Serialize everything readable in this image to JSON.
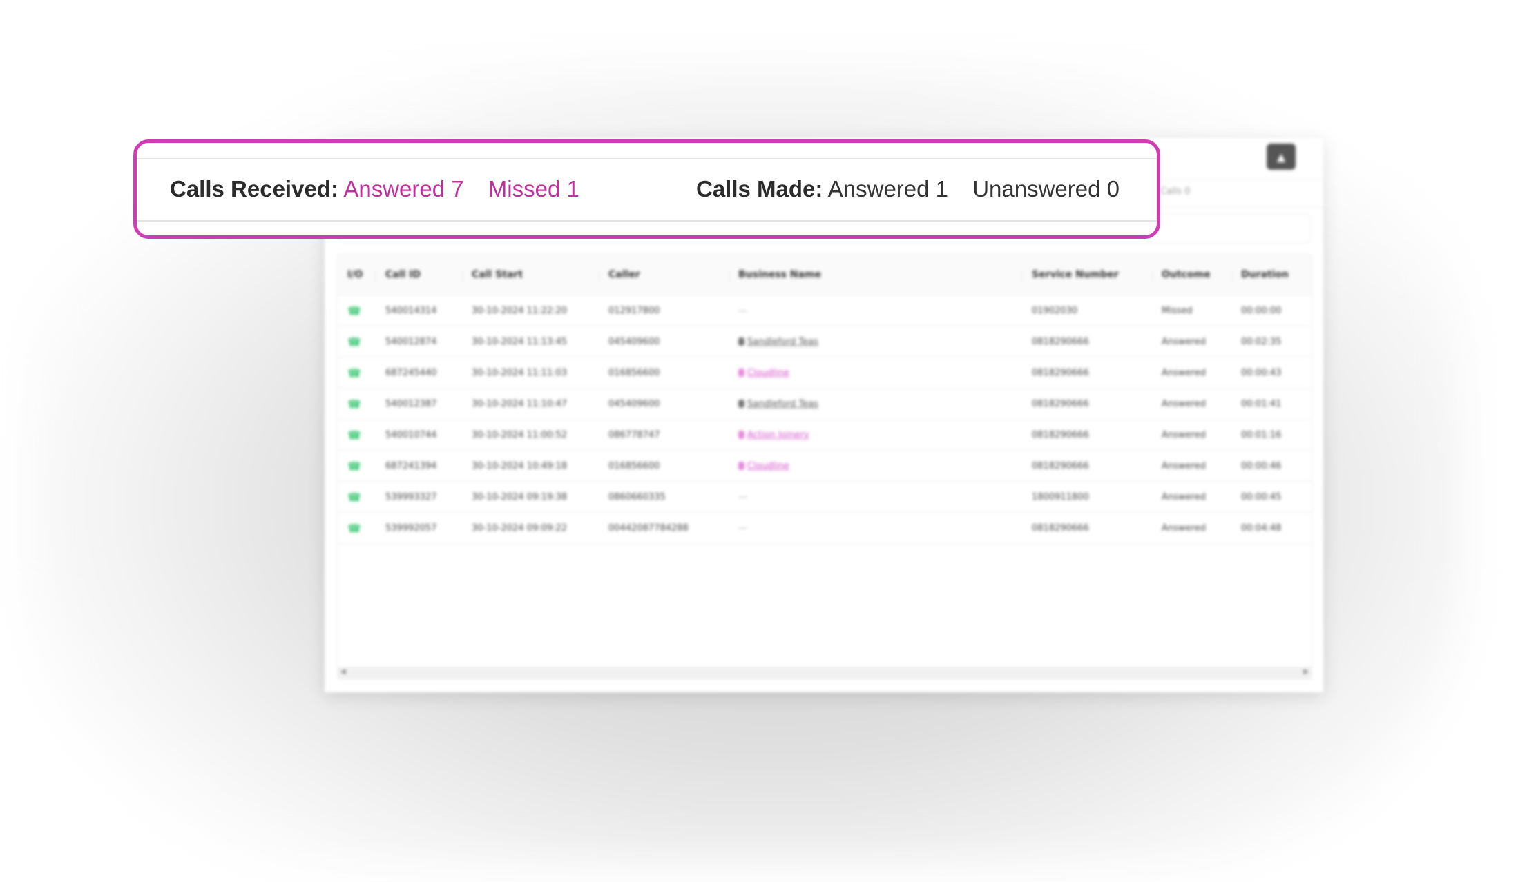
{
  "summary": {
    "calls_received_label": "Calls Received:",
    "received_answered": "Answered 7",
    "received_missed": "Missed 1",
    "calls_made_label": "Calls Made:",
    "made_answered": "Answered 1",
    "made_unanswered": "Unanswered 0",
    "highlight_color": "#d03cb4",
    "accent_color": "#c0309c"
  },
  "card": {
    "export_icon": "upload-icon",
    "summary_strip_text": "Calls 0"
  },
  "table": {
    "columns": [
      "I/O",
      "Call ID",
      "Call Start",
      "Caller",
      "Business Name",
      "Service Number",
      "Outcome",
      "Duration"
    ],
    "rows": [
      {
        "io": "incoming-call",
        "call_id": "540014314",
        "call_start": "30-10-2024 11:22:20",
        "caller": "012917800",
        "business": "—",
        "business_style": "none",
        "service_number": "01902030",
        "outcome": "Missed",
        "duration": "00:00:00"
      },
      {
        "io": "incoming-call",
        "call_id": "540012874",
        "call_start": "30-10-2024 11:13:45",
        "caller": "045409600",
        "business": "Sandleford Teas",
        "business_style": "grey",
        "service_number": "0818290666",
        "outcome": "Answered",
        "duration": "00:02:35"
      },
      {
        "io": "incoming-call",
        "call_id": "687245440",
        "call_start": "30-10-2024 11:11:03",
        "caller": "016856600",
        "business": "Cloudline",
        "business_style": "pink",
        "service_number": "0818290666",
        "outcome": "Answered",
        "duration": "00:00:43"
      },
      {
        "io": "incoming-call",
        "call_id": "540012387",
        "call_start": "30-10-2024 11:10:47",
        "caller": "045409600",
        "business": "Sandleford Teas",
        "business_style": "grey",
        "service_number": "0818290666",
        "outcome": "Answered",
        "duration": "00:01:41"
      },
      {
        "io": "incoming-call",
        "call_id": "540010744",
        "call_start": "30-10-2024 11:00:52",
        "caller": "086778747",
        "business": "Action Joinery",
        "business_style": "pink",
        "service_number": "0818290666",
        "outcome": "Answered",
        "duration": "00:01:16"
      },
      {
        "io": "incoming-call",
        "call_id": "687241394",
        "call_start": "30-10-2024 10:49:18",
        "caller": "016856600",
        "business": "Cloudline",
        "business_style": "pink",
        "service_number": "0818290666",
        "outcome": "Answered",
        "duration": "00:00:46"
      },
      {
        "io": "incoming-call",
        "call_id": "539993327",
        "call_start": "30-10-2024 09:19:38",
        "caller": "0860660335",
        "business": "—",
        "business_style": "none",
        "service_number": "1800911800",
        "outcome": "Answered",
        "duration": "00:00:45"
      },
      {
        "io": "incoming-call",
        "call_id": "539992057",
        "call_start": "30-10-2024 09:09:22",
        "caller": "00442087784288",
        "business": "—",
        "business_style": "none",
        "service_number": "0818290666",
        "outcome": "Answered",
        "duration": "00:04:48"
      }
    ],
    "io_color": "#2ec46a"
  }
}
